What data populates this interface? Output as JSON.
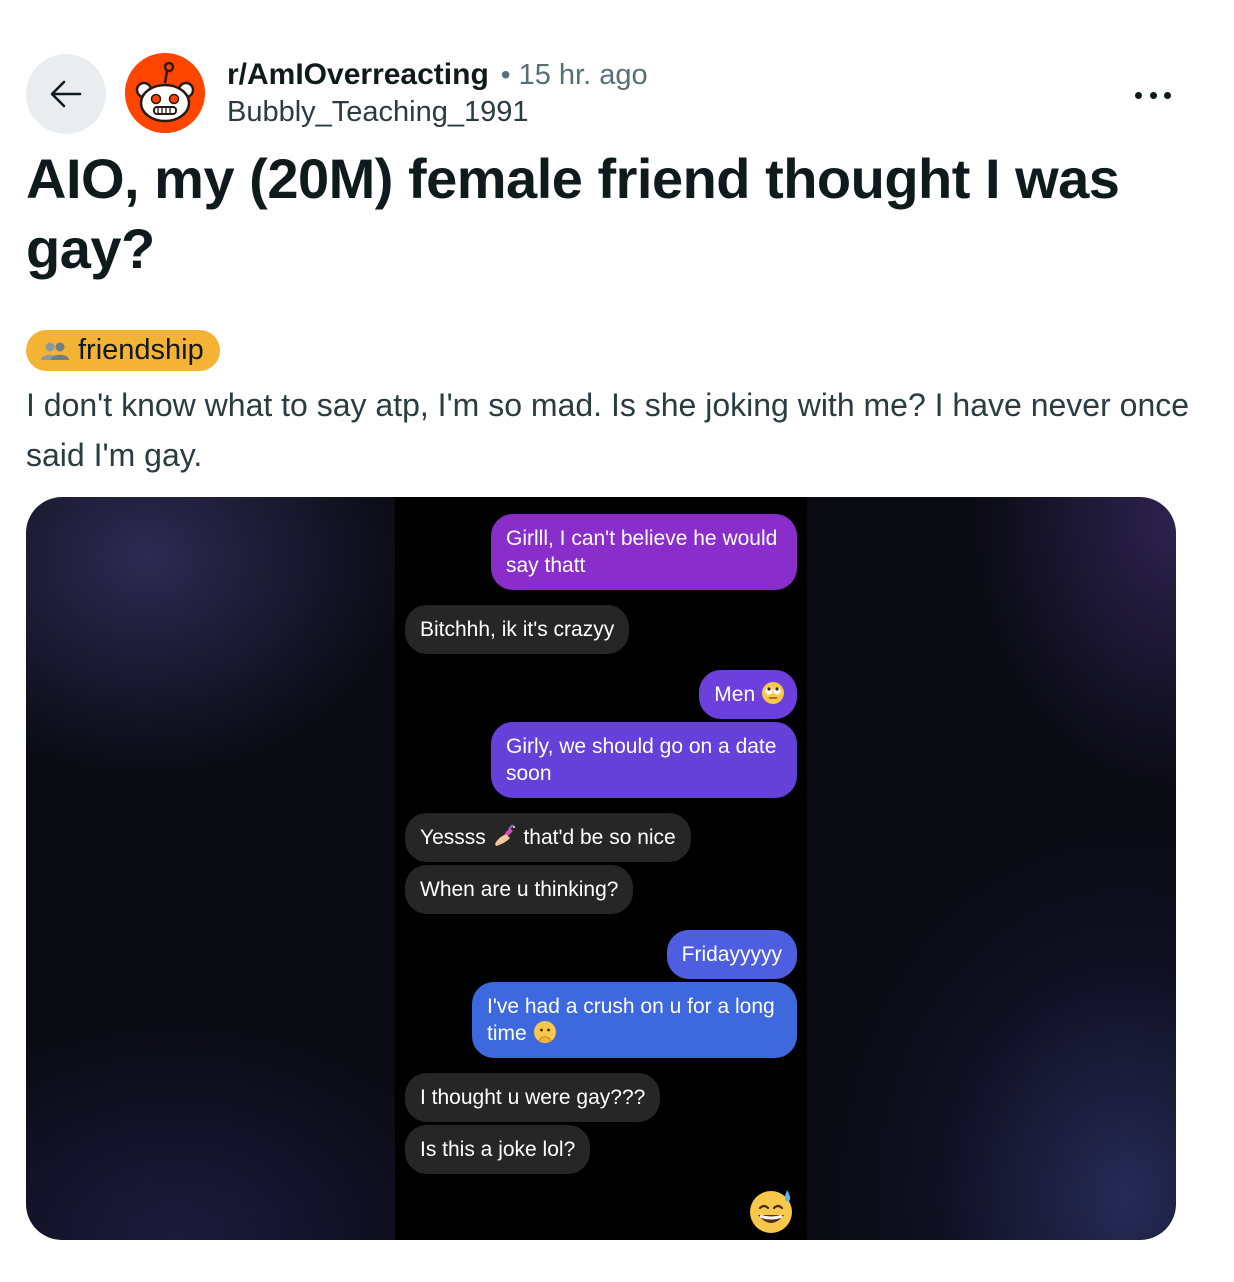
{
  "header": {
    "subreddit": "r/AmIOverreacting",
    "separator": "•",
    "time": "15 hr. ago",
    "author": "Bubbly_Teaching_1991",
    "back_icon": "arrow-left-icon",
    "more_icon": "ellipsis-icon",
    "avatar_icon": "snoo-icon"
  },
  "post": {
    "title": "AIO, my (20M) female friend thought I was gay?",
    "flair": {
      "text": "friendship",
      "icon": "people-icon",
      "color": "#f5b335"
    },
    "body": "I don't know what to say atp, I'm so mad. Is she joking with me? I have never once said I'm gay."
  },
  "chat": {
    "messages": [
      {
        "side": "out",
        "text": "Girlll, I can't believe he would say thatt",
        "color": "#8a2ecb"
      },
      {
        "side": "in",
        "text": "Bitchhh, ik it's crazyy"
      },
      {
        "side": "out",
        "text": "Men",
        "emoji": "eye-roll-emoji",
        "color": "#6d3fdc"
      },
      {
        "side": "out",
        "text": "Girly, we should go on a date soon",
        "color": "#6541da"
      },
      {
        "side": "in",
        "text_before": "Yessss",
        "emoji": "nail-polish-emoji",
        "text_after": "that'd be so nice"
      },
      {
        "side": "in",
        "text": "When are u thinking?"
      },
      {
        "side": "out",
        "text": "Fridayyyyy",
        "color": "#4d5fe0"
      },
      {
        "side": "out",
        "text": "I've had a crush on u for a long time",
        "emoji": "peeking-face-emoji",
        "color": "#3d68de"
      },
      {
        "side": "in",
        "text": "I thought u were gay???"
      },
      {
        "side": "in",
        "text": "Is this a joke lol?"
      }
    ],
    "reaction": "sweat-smile-emoji"
  }
}
